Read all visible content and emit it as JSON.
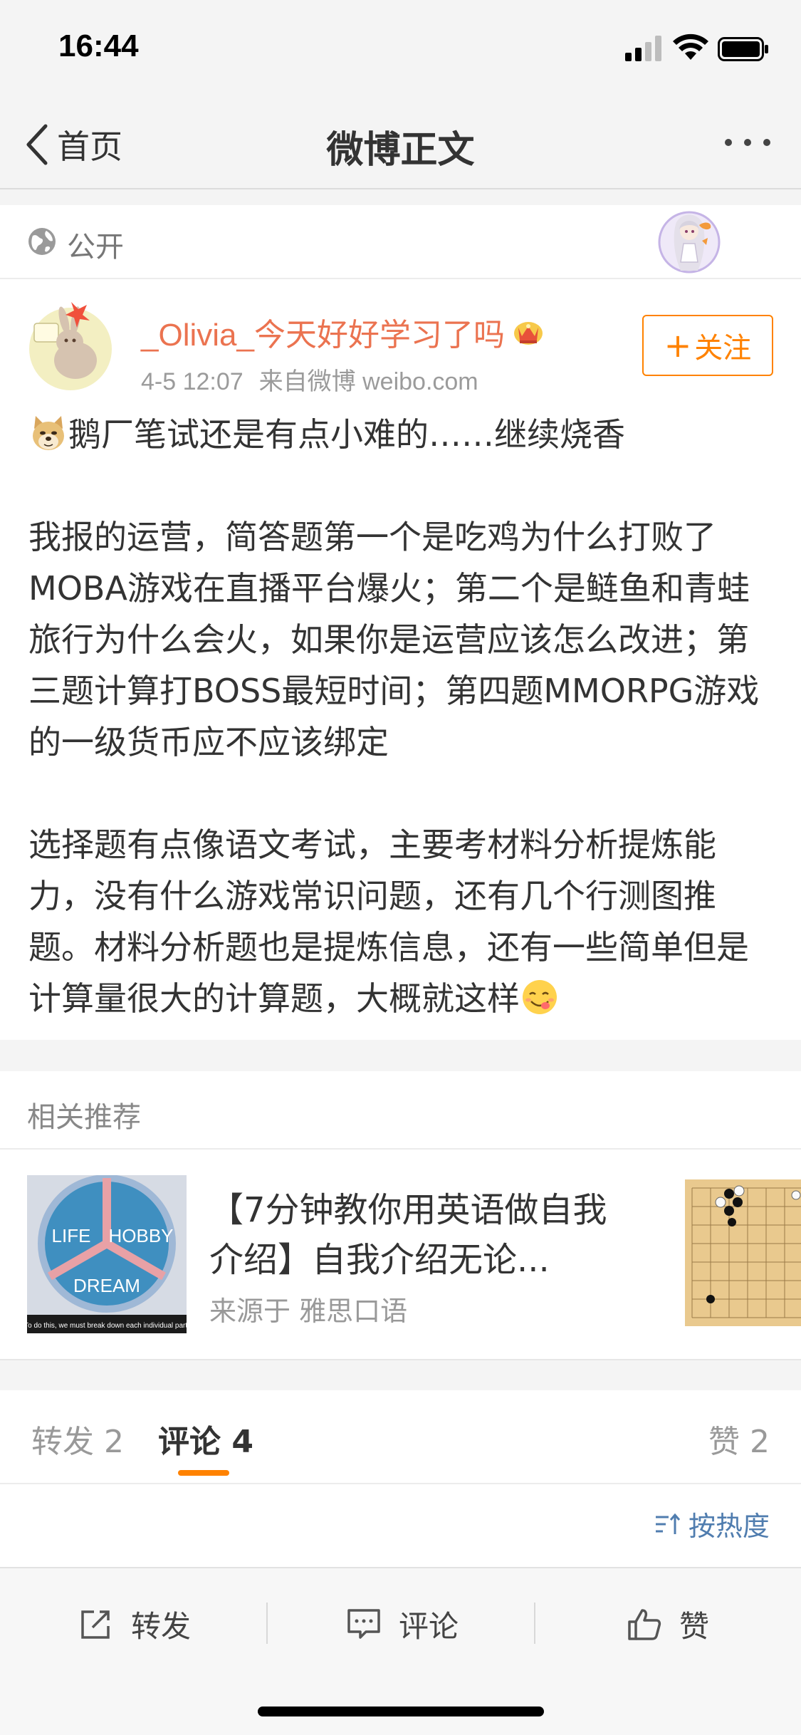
{
  "status_bar": {
    "time": "16:44"
  },
  "nav": {
    "back_label": "首页",
    "title": "微博正文"
  },
  "visibility": {
    "label": "公开"
  },
  "post": {
    "username": "_Olivia_今天好好学习了吗",
    "date": "4-5 12:07",
    "source": "来自微博 weibo.com",
    "follow_label": "关注",
    "paragraph_1": "鹅厂笔试还是有点小难的……继续烧香",
    "paragraph_2": "我报的运营，简答题第一个是吃鸡为什么打败了MOBA游戏在直播平台爆火；第二个是鲢鱼和青蛙旅行为什么会火，如果你是运营应该怎么改进；第三题计算打BOSS最短时间；第四题MMORPG游戏的一级货币应不应该绑定",
    "paragraph_3": "选择题有点像语文考试，主要考材料分析提炼能力，没有什么游戏常识问题，还有几个行测图推题。材料分析题也是提炼信息，还有一些简单但是计算量很大的计算题，大概就这样"
  },
  "related": {
    "heading": "相关推荐",
    "title": "【7分钟教你用英语做自我介绍】自我介绍无论...",
    "source": "来源于 雅思口语",
    "thumb_words": [
      "LIFE",
      "HOBBY",
      "DREAM"
    ],
    "thumb_caption": "To do this, we must break down each individual part."
  },
  "tabs": {
    "reposts": "转发 2",
    "comments": "评论 4",
    "likes": "赞 2"
  },
  "sort_label": "按热度",
  "toolbar": {
    "repost": "转发",
    "comment": "评论",
    "like": "赞"
  },
  "colors": {
    "accent": "#ff8200",
    "username": "#eb7350",
    "link": "#507daf"
  }
}
